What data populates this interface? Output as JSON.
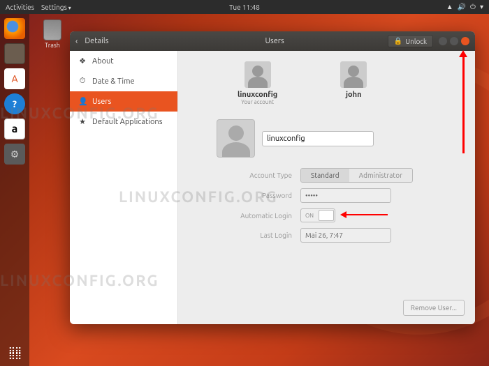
{
  "topbar": {
    "activities": "Activities",
    "app_name": "Settings",
    "clock": "Tue 11:48"
  },
  "desktop": {
    "trash_label": "Trash"
  },
  "window": {
    "section": "Details",
    "title": "Users",
    "unlock": "Unlock"
  },
  "sidebar": {
    "items": [
      {
        "icon": "❖",
        "label": "About"
      },
      {
        "icon": "⏱",
        "label": "Date & Time"
      },
      {
        "icon": "👤",
        "label": "Users"
      },
      {
        "icon": "★",
        "label": "Default Applications"
      }
    ]
  },
  "users": [
    {
      "name": "linuxconfig",
      "sub": "Your account"
    },
    {
      "name": "john",
      "sub": ""
    }
  ],
  "form": {
    "username_value": "linuxconfig",
    "account_type_label": "Account Type",
    "account_type_standard": "Standard",
    "account_type_admin": "Administrator",
    "password_label": "Password",
    "password_value": "•••••",
    "auto_login_label": "Automatic Login",
    "auto_login_value": "ON",
    "last_login_label": "Last Login",
    "last_login_value": "Mai 26, 7:47",
    "remove_user": "Remove User..."
  },
  "watermark": "LINUXCONFIG.ORG"
}
